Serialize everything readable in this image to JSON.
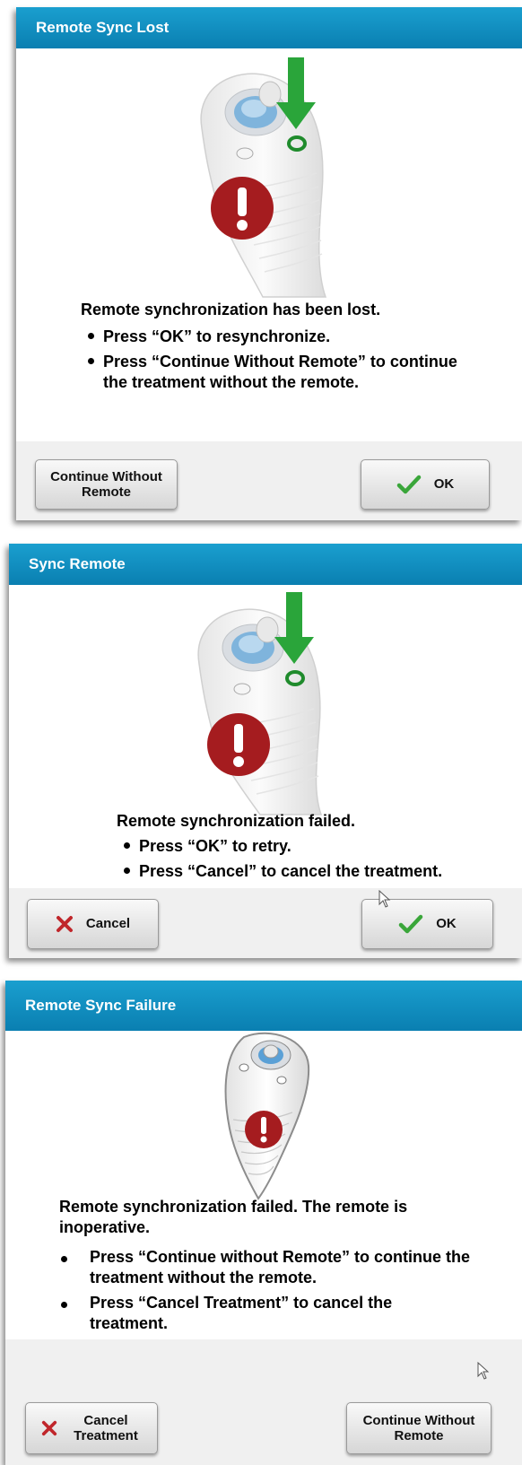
{
  "dialogs": [
    {
      "title": "Remote Sync Lost",
      "message": "Remote synchronization has been lost.",
      "bullets": [
        "Press “OK” to resynchronize.",
        "Press “Continue Without Remote” to continue the treatment without the remote."
      ],
      "left_button": "Continue Without Remote",
      "right_button": "OK"
    },
    {
      "title": "Sync Remote",
      "message": "Remote synchronization failed.",
      "bullets": [
        "Press “OK” to retry.",
        "Press “Cancel” to cancel the treatment."
      ],
      "left_button": "Cancel",
      "right_button": "OK"
    },
    {
      "title": "Remote Sync Failure",
      "message": "Remote synchronization failed.  The remote is inoperative.",
      "bullets": [
        "Press “Continue without Remote” to continue the treatment without the remote.",
        "Press “Cancel Treatment” to cancel the treatment."
      ],
      "left_button": "Cancel Treatment",
      "right_button": "Continue Without Remote"
    }
  ],
  "colors": {
    "title_bar": "#1593c6",
    "alert_red": "#a51c1f",
    "arrow_green": "#2aa53a",
    "check_green": "#3aa63a",
    "cancel_red": "#c0262b"
  },
  "icons": [
    "remote-control-illustration",
    "alert-icon",
    "sync-arrow-icon",
    "check-icon",
    "x-icon",
    "mouse-cursor-icon"
  ]
}
